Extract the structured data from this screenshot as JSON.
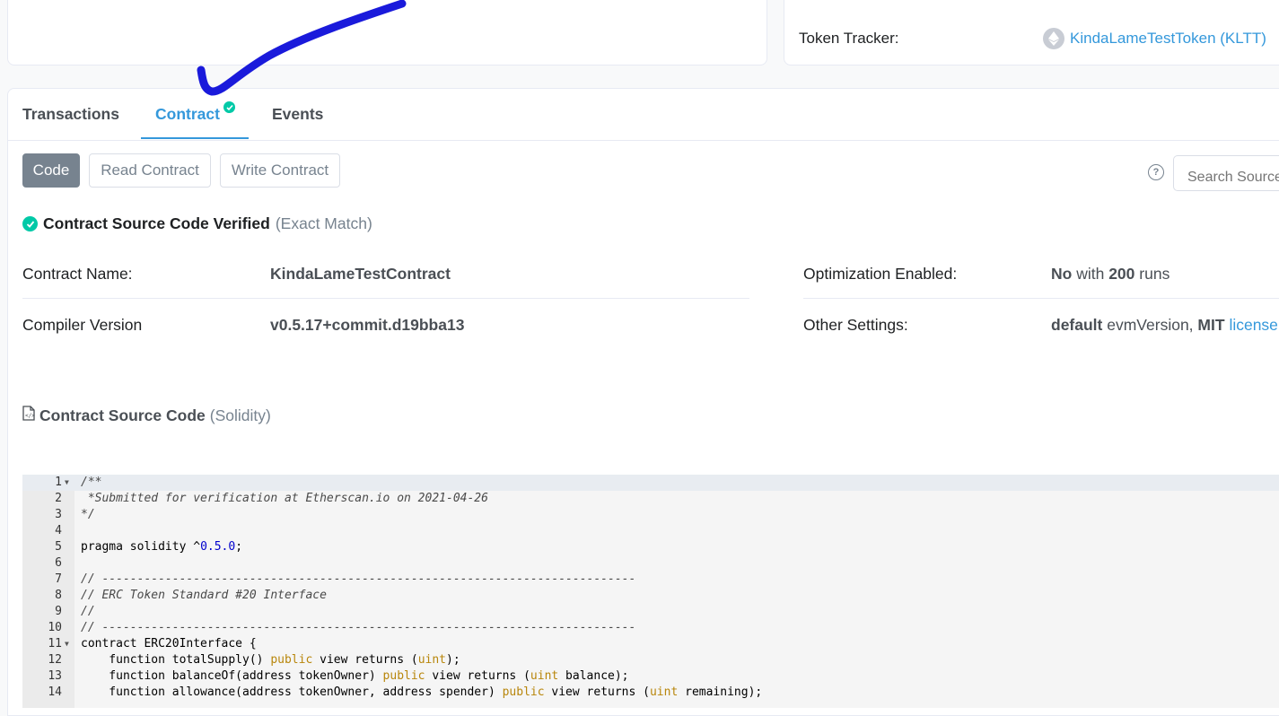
{
  "token_tracker": {
    "label": "Token Tracker:",
    "link": "KindaLameTestToken (KLTT)"
  },
  "tabs": {
    "transactions": "Transactions",
    "contract": "Contract",
    "events": "Events"
  },
  "sub_buttons": {
    "code": "Code",
    "read": "Read Contract",
    "write": "Write Contract"
  },
  "search": {
    "placeholder": "Search Source Code"
  },
  "verified": {
    "title": "Contract Source Code Verified",
    "match": "(Exact Match)"
  },
  "contract_info": {
    "name_label": "Contract Name:",
    "name_value": "KindaLameTestContract",
    "compiler_label": "Compiler Version",
    "compiler_value": "v0.5.17+commit.d19bba13",
    "optimization_label": "Optimization Enabled:",
    "optimization_value": "No",
    "optimization_with": "with",
    "optimization_runs": "200",
    "optimization_runs_suffix": "runs",
    "settings_label": "Other Settings:",
    "settings_default": "default",
    "settings_evm": "evmVersion,",
    "settings_license": "MIT",
    "settings_license_link": "license"
  },
  "source_title": {
    "title": "Contract Source Code",
    "lang": "(Solidity)"
  },
  "code_lines": [
    "/**",
    " *Submitted for verification at Etherscan.io on 2021-04-26",
    "*/",
    "",
    "pragma solidity ^0.5.0;",
    "",
    "// ----------------------------------------------------------------------------",
    "// ERC Token Standard #20 Interface",
    "//",
    "// ----------------------------------------------------------------------------",
    "contract ERC20Interface {",
    "    function totalSupply() public view returns (uint);",
    "    function balanceOf(address tokenOwner) public view returns (uint balance);",
    "    function allowance(address tokenOwner, address spender) public view returns (uint remaining);"
  ],
  "line_numbers": [
    "1",
    "2",
    "3",
    "4",
    "5",
    "6",
    "7",
    "8",
    "9",
    "10",
    "11",
    "12",
    "13",
    "14"
  ],
  "colors": {
    "accent": "#3498db",
    "verified": "#00c9a7",
    "annotation": "#1a1adb"
  }
}
